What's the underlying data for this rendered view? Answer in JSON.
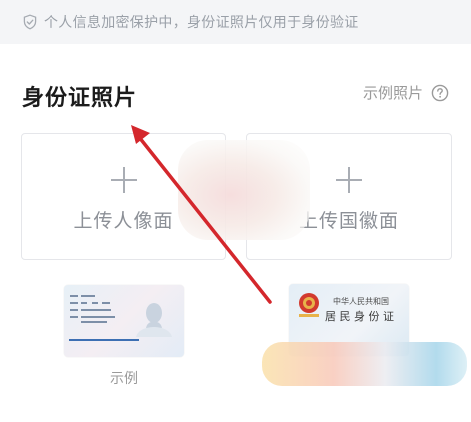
{
  "notice": {
    "icon": "shield-check-icon",
    "text": "个人信息加密保护中，身份证照片仅用于身份验证"
  },
  "section": {
    "title": "身份证照片",
    "sample_link": "示例照片",
    "help_icon": "question-circle-icon"
  },
  "upload": {
    "front_label": "上传人像面",
    "back_label": "上传国徽面"
  },
  "samples": {
    "caption": "示例",
    "back_title_line1": "中华人民共和国",
    "back_title_line2": "居 民 身 份 证"
  },
  "colors": {
    "arrow": "#d4272c",
    "muted_text": "#9a9a9a",
    "notice_bg": "#f4f5f7"
  }
}
